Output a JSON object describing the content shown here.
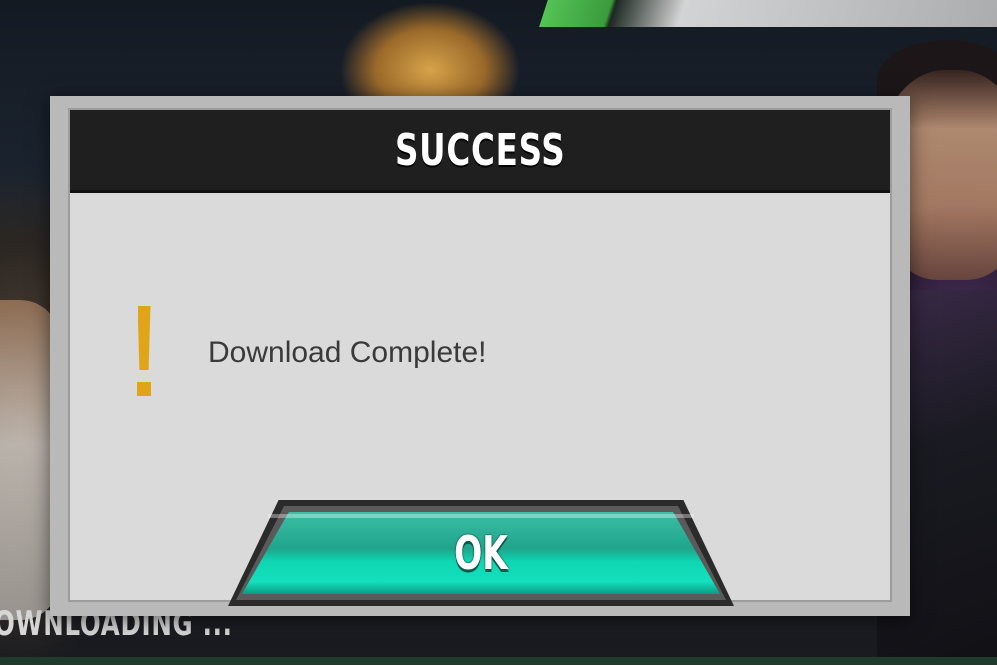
{
  "background": {
    "loading_text": "OWNLOADING ..."
  },
  "dialog": {
    "title": "SUCCESS",
    "icon": "exclamation-icon",
    "message": "Download Complete!",
    "ok_label": "OK"
  },
  "colors": {
    "title_bar": "#1f1f1f",
    "dialog_body": "#dadada",
    "alert_icon": "#e0a419",
    "ok_button": "#14e0bd"
  }
}
